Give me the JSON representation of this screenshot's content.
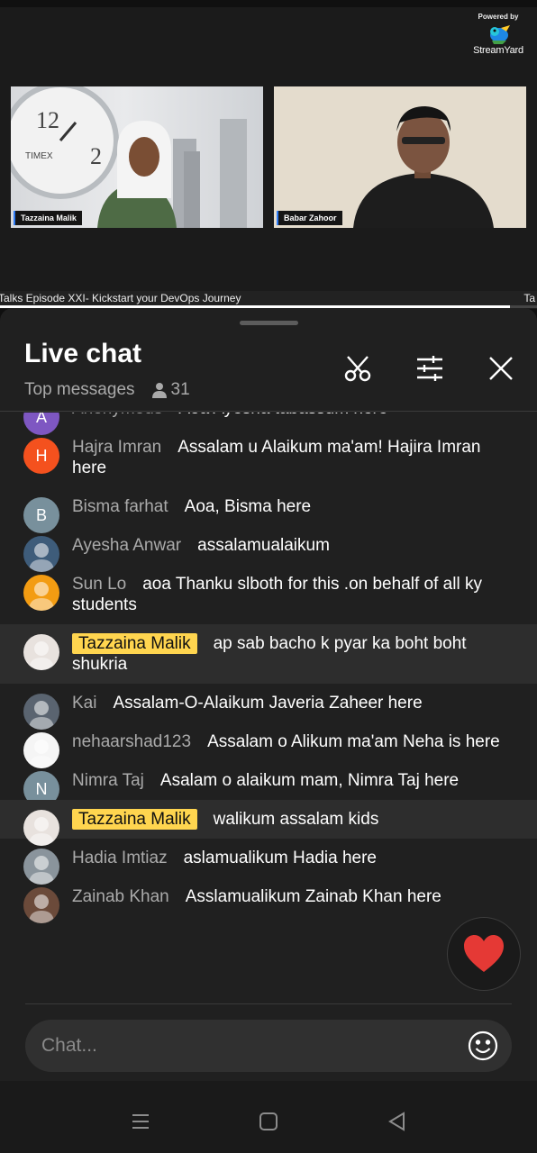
{
  "video": {
    "branding": {
      "powered_by": "Powered by",
      "name": "StreamYard"
    },
    "participants": [
      {
        "name": "Tazzaina Malik"
      },
      {
        "name": "Babar Zahoor"
      }
    ],
    "ticker": {
      "text": "Talks Episode XXI- Kickstart your DevOps Journey",
      "trailing": "Ta"
    },
    "progress": 0.95
  },
  "chat": {
    "title": "Live chat",
    "filter_label": "Top messages",
    "viewer_count": "31",
    "header_icons": [
      "scissors-icon",
      "sliders-icon",
      "close-icon"
    ],
    "messages": [
      {
        "author": "Anonymous",
        "text": "Aoa Ayesha tabassum here",
        "avatar_letter": "A",
        "avatar_color": "#7e57c2",
        "owner": false
      },
      {
        "author": "Hajra Imran",
        "text": "Assalam u Alaikum ma'am! Hajira Imran here",
        "avatar_letter": "H",
        "avatar_color": "#f4511e",
        "owner": false
      },
      {
        "author": "Bisma farhat",
        "text": "Aoa, Bisma here",
        "avatar_letter": "B",
        "avatar_color": "#78909c",
        "owner": false
      },
      {
        "author": "Ayesha Anwar",
        "text": "assalamualaikum",
        "avatar_letter": "",
        "avatar_color": "#3e5c7a",
        "owner": false
      },
      {
        "author": "Sun Lo",
        "text": "aoa Thanku slboth for this .on behalf of all ky students",
        "avatar_letter": "",
        "avatar_color": "#f39c12",
        "owner": false
      },
      {
        "author": "Tazzaina Malik",
        "text": "ap sab bacho k pyar ka boht boht shukria",
        "avatar_letter": "",
        "avatar_color": "#e8e2de",
        "owner": true
      },
      {
        "author": "Kai",
        "text": "Assalam-O-Alaikum Javeria Zaheer here",
        "avatar_letter": "",
        "avatar_color": "#5a6470",
        "owner": false
      },
      {
        "author": "nehaarshad123",
        "text": "Assalam o Alikum ma'am Neha is here",
        "avatar_letter": "",
        "avatar_color": "#f5f5f5",
        "owner": false
      },
      {
        "author": "Nimra Taj",
        "text": "Asalam o alaikum mam, Nimra Taj here",
        "avatar_letter": "N",
        "avatar_color": "#78909c",
        "owner": false
      },
      {
        "author": "Tazzaina Malik",
        "text": "walikum assalam kids",
        "avatar_letter": "",
        "avatar_color": "#e8e2de",
        "owner": true
      },
      {
        "author": "Hadia Imtiaz",
        "text": "aslamualikum Hadia here",
        "avatar_letter": "",
        "avatar_color": "#8a949c",
        "owner": false
      },
      {
        "author": "Zainab Khan",
        "text": "Asslamualikum Zainab Khan here",
        "avatar_letter": "",
        "avatar_color": "#6b4a3a",
        "owner": false
      }
    ],
    "input": {
      "placeholder": "Chat..."
    },
    "reaction_icon": "heart-icon",
    "emoji_icon": "smiley-icon"
  },
  "nav": {
    "icons": [
      "recents-icon",
      "home-icon",
      "back-icon"
    ]
  },
  "colors": {
    "owner_badge": "#ffd54f",
    "panel_bg": "#202020",
    "heart": "#e53935"
  }
}
